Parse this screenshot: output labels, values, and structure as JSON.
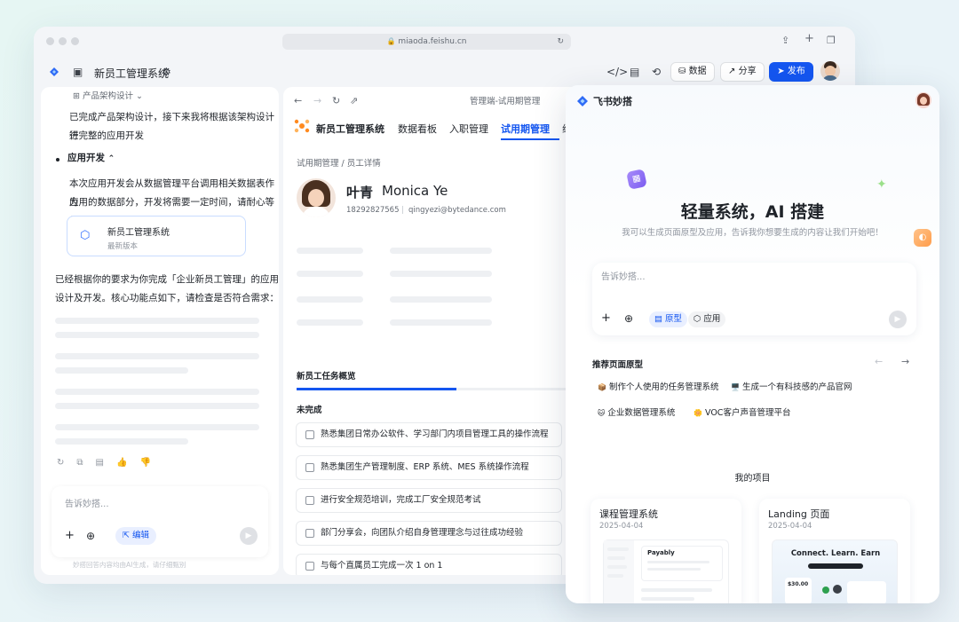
{
  "browser": {
    "url": "miaoda.feishu.cn",
    "app_title": "新员工管理系统",
    "data_label": "数据",
    "share_label": "分享",
    "publish_label": "发布"
  },
  "chat": {
    "step_label": "产品架构设计",
    "step_text_1": "已完成产品架构设计，接下来我将根据该架构设计进",
    "step_text_2": "行完整的应用开发",
    "section_label": "应用开发",
    "dev_text_1": "本次应用开发会从数据管理平台调用相关数据表作为",
    "dev_text_2": "应用的数据部分，开发将需要一定时间，请耐心等待",
    "card_title": "新员工管理系统",
    "card_sub": "最新版本",
    "summary_1": "已经根据你的要求为你完成「企业新员工管理」的应用",
    "summary_2": "设计及开发。核心功能点如下，请检查是否符合需求：",
    "input_placeholder": "告诉妙搭...",
    "edit_label": "编辑",
    "disclaimer": "妙搭回答内容均由AI生成，请仔细甄别"
  },
  "preview": {
    "page_title": "管理端-试用期管理",
    "app_name": "新员工管理系统",
    "tabs": [
      "数据看板",
      "入职管理",
      "试用期管理",
      "组"
    ],
    "breadcrumb": "试用期管理 / 员工详情",
    "employee_name_cn": "叶青",
    "employee_name_en": "Monica Ye",
    "phone": "18292827565",
    "email": "qingyezi@bytedance.com",
    "overview_label": "新员工任务概览",
    "status_label": "未完成",
    "tasks": [
      "熟悉集团日常办公软件、学习部门内项目管理工具的操作流程",
      "熟悉集团生产管理制度、ERP 系统、MES 系统操作流程",
      "进行安全规范培训，完成工厂安全规范考试",
      "部门分享会，向团队介绍自身管理理念与过往成功经验",
      "与每个直属员工完成一次 1 on 1"
    ]
  },
  "miaoda": {
    "brand": "飞书妙搭",
    "headline": "轻量系统，AI 搭建",
    "subtitle": "我可以生成页面原型及应用，告诉我你想要生成的内容让我们开始吧！",
    "prompt_placeholder": "告诉妙搭...",
    "chip_prototype": "原型",
    "chip_app": "应用",
    "rec_title": "推荐页面原型",
    "rec_items": [
      "制作个人使用的任务管理系统",
      "生成一个有科技感的产品官网",
      "企业数据管理系统",
      "VOC客户声音管理平台"
    ],
    "rec_icons": [
      "📦",
      "🖥️",
      "🐱",
      "🌼"
    ],
    "projects_title": "我的项目",
    "projects": [
      {
        "name": "课程管理系统",
        "date": "2025-04-04",
        "mini_title": "Payably"
      },
      {
        "name": "Landing 页面",
        "date": "2025-04-04",
        "mini_title": "Connect. Learn. Earn",
        "mini_value": "$30.00"
      }
    ]
  },
  "colors": {
    "accent": "#1456f0",
    "accent_light": "#e9efff",
    "text": "#1f2329",
    "muted": "#8f959e"
  }
}
